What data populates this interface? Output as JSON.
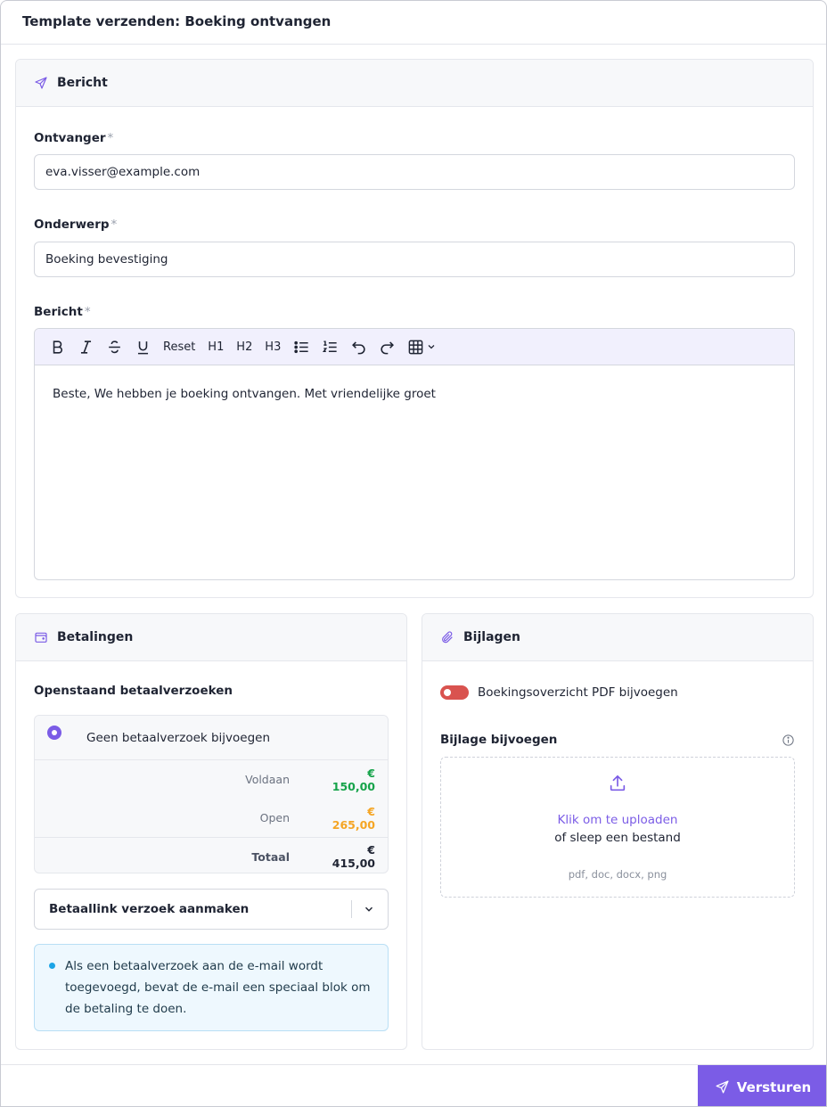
{
  "modal": {
    "title": "Template verzenden: Boeking ontvangen"
  },
  "message_card": {
    "title": "Bericht",
    "recipient_label": "Ontvanger",
    "recipient_value": "eva.visser@example.com",
    "subject_label": "Onderwerp",
    "subject_value": "Boeking bevestiging",
    "body_label": "Bericht",
    "required_mark": "*",
    "toolbar": {
      "reset": "Reset",
      "h1": "H1",
      "h2": "H2",
      "h3": "H3"
    },
    "body_text": "Beste, We hebben je boeking ontvangen. Met vriendelijke groet"
  },
  "payments_card": {
    "title": "Betalingen",
    "subtitle": "Openstaand betaalverzoeken",
    "radio_label": "Geen betaalverzoek bijvoegen",
    "rows": [
      {
        "label": "Voldaan",
        "value": "€ 150,00",
        "color": "#16a34a"
      },
      {
        "label": "Open",
        "value": "€ 265,00",
        "color": "#f5a524"
      }
    ],
    "total": {
      "label": "Totaal",
      "value": "€ 415,00"
    },
    "select_value": "Betaallink verzoek aanmaken",
    "info_text": "Als een betaalverzoek aan de e-mail wordt toegevoegd, bevat de e-mail een speciaal blok om de betaling te doen."
  },
  "attachments_card": {
    "title": "Bijlagen",
    "toggle_label": "Boekingsoverzicht PDF bijvoegen",
    "toggle_on": false,
    "upload_label": "Bijlage bijvoegen",
    "click_text": "Klik om te uploaden",
    "drag_text": "of sleep een bestand",
    "file_types": "pdf, doc, docx, png"
  },
  "footer": {
    "send_label": "Versturen"
  },
  "colors": {
    "accent": "#7b5ce6",
    "toggle_off": "#d9534f",
    "info_bg": "#eef8fe"
  }
}
